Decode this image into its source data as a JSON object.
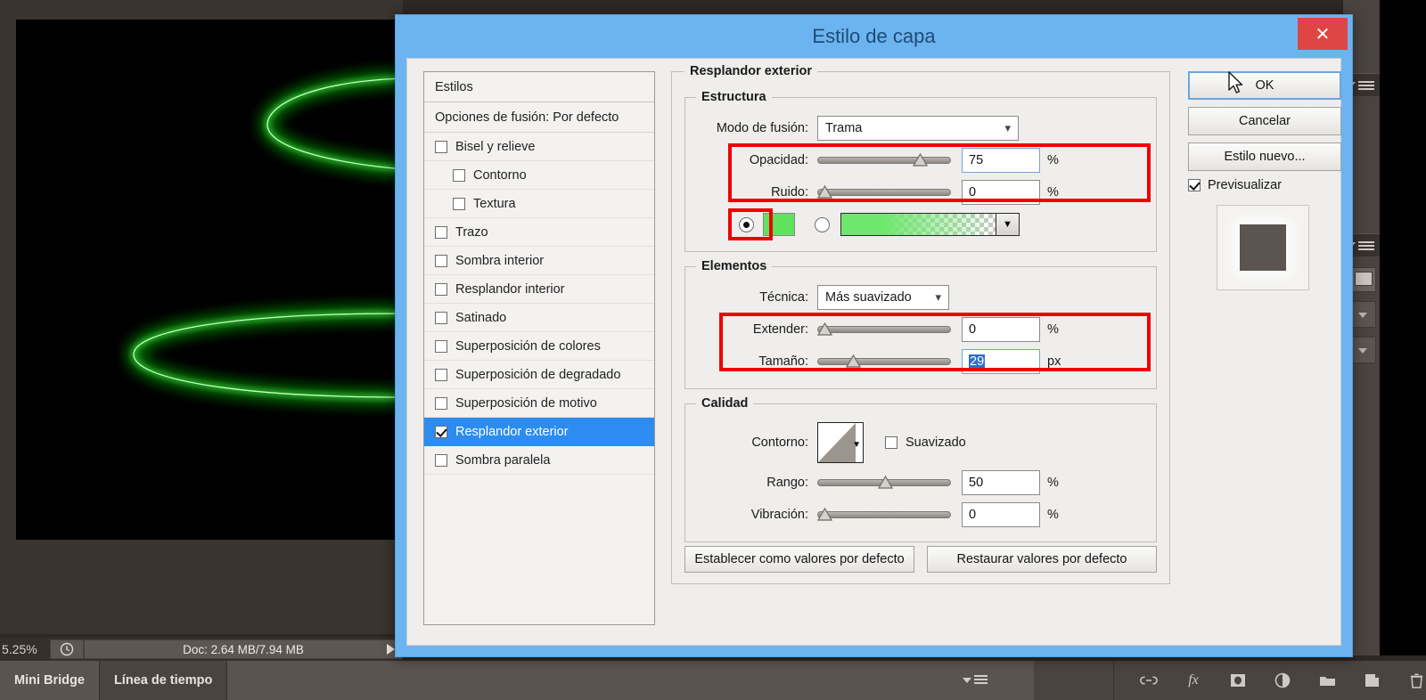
{
  "dialog": {
    "title": "Estilo de capa",
    "close_label": "✕"
  },
  "styles_panel": {
    "header": "Estilos",
    "blending": "Opciones de fusión: Por defecto",
    "items": [
      {
        "label": "Bisel y relieve",
        "checked": false,
        "indent": false,
        "selected": false
      },
      {
        "label": "Contorno",
        "checked": false,
        "indent": true,
        "selected": false
      },
      {
        "label": "Textura",
        "checked": false,
        "indent": true,
        "selected": false
      },
      {
        "label": "Trazo",
        "checked": false,
        "indent": false,
        "selected": false
      },
      {
        "label": "Sombra interior",
        "checked": false,
        "indent": false,
        "selected": false
      },
      {
        "label": "Resplandor interior",
        "checked": false,
        "indent": false,
        "selected": false
      },
      {
        "label": "Satinado",
        "checked": false,
        "indent": false,
        "selected": false
      },
      {
        "label": "Superposición de colores",
        "checked": false,
        "indent": false,
        "selected": false
      },
      {
        "label": "Superposición de degradado",
        "checked": false,
        "indent": false,
        "selected": false
      },
      {
        "label": "Superposición de motivo",
        "checked": false,
        "indent": false,
        "selected": false
      },
      {
        "label": "Resplandor exterior",
        "checked": true,
        "indent": false,
        "selected": true
      },
      {
        "label": "Sombra paralela",
        "checked": false,
        "indent": false,
        "selected": false
      }
    ]
  },
  "outer_glow": {
    "group_title": "Resplandor exterior",
    "structure": {
      "title": "Estructura",
      "blend_mode_label": "Modo de fusión:",
      "blend_mode_value": "Trama",
      "opacity_label": "Opacidad:",
      "opacity_value": "75",
      "opacity_unit": "%",
      "noise_label": "Ruido:",
      "noise_value": "0",
      "noise_unit": "%",
      "color_mode": "solid",
      "color_hex": "#5fe35f",
      "gradient_from": "#6fe76f",
      "gradient_to": "#ffffff"
    },
    "elements": {
      "title": "Elementos",
      "technique_label": "Técnica:",
      "technique_value": "Más suavizado",
      "spread_label": "Extender:",
      "spread_value": "0",
      "spread_unit": "%",
      "size_label": "Tamaño:",
      "size_value": "29",
      "size_unit": "px"
    },
    "quality": {
      "title": "Calidad",
      "contour_label": "Contorno:",
      "antialias_label": "Suavizado",
      "antialias_checked": false,
      "range_label": "Rango:",
      "range_value": "50",
      "range_unit": "%",
      "jitter_label": "Vibración:",
      "jitter_value": "0",
      "jitter_unit": "%"
    },
    "defaults": {
      "set_label": "Establecer como valores por defecto",
      "reset_label": "Restaurar valores por defecto"
    }
  },
  "actions": {
    "ok": "OK",
    "cancel": "Cancelar",
    "new_style": "Estilo nuevo...",
    "preview": "Previsualizar",
    "preview_checked": true
  },
  "statusbar": {
    "zoom": "5.25%",
    "doc": "Doc: 2.64 MB/7.94 MB"
  },
  "bottom_tabs": [
    {
      "label": "Mini Bridge",
      "active": true
    },
    {
      "label": "Línea de tiempo",
      "active": false
    }
  ],
  "layer_toolbar_icons": [
    "link-icon",
    "fx-icon",
    "mask-icon",
    "adjustment-icon",
    "folder-icon",
    "new-layer-icon",
    "trash-icon"
  ],
  "colors": {
    "title_bar": "#6cb4f0",
    "close_button": "#e04545",
    "selection": "#2c8cf0",
    "highlight_box": "#ee0000",
    "glow_green": "#28e028"
  }
}
